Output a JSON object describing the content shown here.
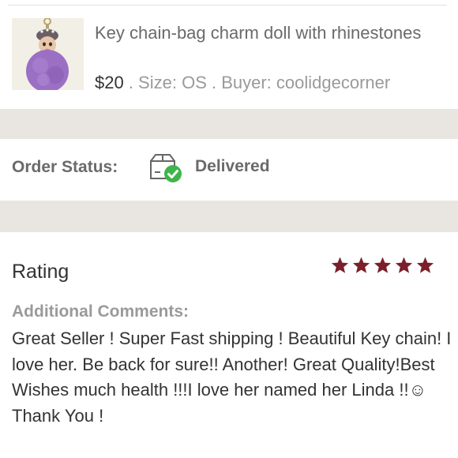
{
  "item": {
    "title": "Key chain-bag charm doll with rhinestones",
    "price": "$20",
    "size": " . Size: OS",
    "buyer": " . Buyer: coolidgecorner",
    "thumbnail_icon": "purple-pom-pom-doll-keychain"
  },
  "order_status": {
    "label": "Order Status:",
    "icon": "box-check-icon",
    "value": "Delivered",
    "check_color": "#3db54a"
  },
  "rating": {
    "title": "Rating",
    "stars": 5,
    "max_stars": 5,
    "star_color": "#7a1f2b"
  },
  "comments": {
    "label": "Additional Comments:",
    "text": "Great Seller ! Super Fast shipping ! Beautiful Key chain! I love her. Be back for sure!! Another! Great Quality!Best Wishes much health !!!I love her named her Linda !!☺ Thank You !"
  }
}
